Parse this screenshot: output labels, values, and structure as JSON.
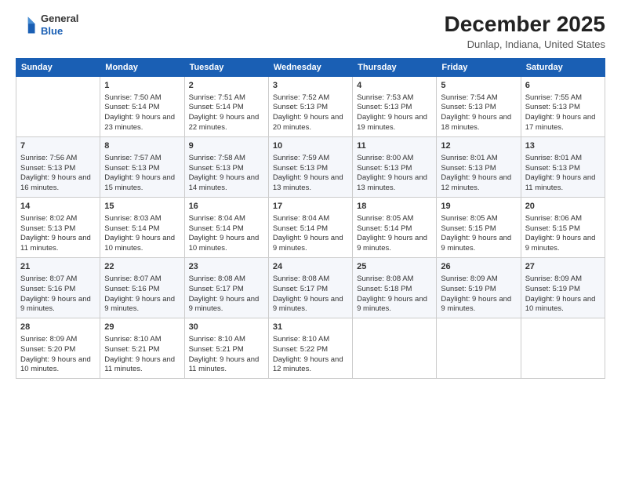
{
  "header": {
    "logo_general": "General",
    "logo_blue": "Blue",
    "title": "December 2025",
    "location": "Dunlap, Indiana, United States"
  },
  "calendar": {
    "days_of_week": [
      "Sunday",
      "Monday",
      "Tuesday",
      "Wednesday",
      "Thursday",
      "Friday",
      "Saturday"
    ],
    "weeks": [
      [
        {
          "day": "",
          "info": ""
        },
        {
          "day": "1",
          "info": "Sunrise: 7:50 AM\nSunset: 5:14 PM\nDaylight: 9 hours and 23 minutes."
        },
        {
          "day": "2",
          "info": "Sunrise: 7:51 AM\nSunset: 5:14 PM\nDaylight: 9 hours and 22 minutes."
        },
        {
          "day": "3",
          "info": "Sunrise: 7:52 AM\nSunset: 5:13 PM\nDaylight: 9 hours and 20 minutes."
        },
        {
          "day": "4",
          "info": "Sunrise: 7:53 AM\nSunset: 5:13 PM\nDaylight: 9 hours and 19 minutes."
        },
        {
          "day": "5",
          "info": "Sunrise: 7:54 AM\nSunset: 5:13 PM\nDaylight: 9 hours and 18 minutes."
        },
        {
          "day": "6",
          "info": "Sunrise: 7:55 AM\nSunset: 5:13 PM\nDaylight: 9 hours and 17 minutes."
        }
      ],
      [
        {
          "day": "7",
          "info": "Sunrise: 7:56 AM\nSunset: 5:13 PM\nDaylight: 9 hours and 16 minutes."
        },
        {
          "day": "8",
          "info": "Sunrise: 7:57 AM\nSunset: 5:13 PM\nDaylight: 9 hours and 15 minutes."
        },
        {
          "day": "9",
          "info": "Sunrise: 7:58 AM\nSunset: 5:13 PM\nDaylight: 9 hours and 14 minutes."
        },
        {
          "day": "10",
          "info": "Sunrise: 7:59 AM\nSunset: 5:13 PM\nDaylight: 9 hours and 13 minutes."
        },
        {
          "day": "11",
          "info": "Sunrise: 8:00 AM\nSunset: 5:13 PM\nDaylight: 9 hours and 13 minutes."
        },
        {
          "day": "12",
          "info": "Sunrise: 8:01 AM\nSunset: 5:13 PM\nDaylight: 9 hours and 12 minutes."
        },
        {
          "day": "13",
          "info": "Sunrise: 8:01 AM\nSunset: 5:13 PM\nDaylight: 9 hours and 11 minutes."
        }
      ],
      [
        {
          "day": "14",
          "info": "Sunrise: 8:02 AM\nSunset: 5:13 PM\nDaylight: 9 hours and 11 minutes."
        },
        {
          "day": "15",
          "info": "Sunrise: 8:03 AM\nSunset: 5:14 PM\nDaylight: 9 hours and 10 minutes."
        },
        {
          "day": "16",
          "info": "Sunrise: 8:04 AM\nSunset: 5:14 PM\nDaylight: 9 hours and 10 minutes."
        },
        {
          "day": "17",
          "info": "Sunrise: 8:04 AM\nSunset: 5:14 PM\nDaylight: 9 hours and 9 minutes."
        },
        {
          "day": "18",
          "info": "Sunrise: 8:05 AM\nSunset: 5:14 PM\nDaylight: 9 hours and 9 minutes."
        },
        {
          "day": "19",
          "info": "Sunrise: 8:05 AM\nSunset: 5:15 PM\nDaylight: 9 hours and 9 minutes."
        },
        {
          "day": "20",
          "info": "Sunrise: 8:06 AM\nSunset: 5:15 PM\nDaylight: 9 hours and 9 minutes."
        }
      ],
      [
        {
          "day": "21",
          "info": "Sunrise: 8:07 AM\nSunset: 5:16 PM\nDaylight: 9 hours and 9 minutes."
        },
        {
          "day": "22",
          "info": "Sunrise: 8:07 AM\nSunset: 5:16 PM\nDaylight: 9 hours and 9 minutes."
        },
        {
          "day": "23",
          "info": "Sunrise: 8:08 AM\nSunset: 5:17 PM\nDaylight: 9 hours and 9 minutes."
        },
        {
          "day": "24",
          "info": "Sunrise: 8:08 AM\nSunset: 5:17 PM\nDaylight: 9 hours and 9 minutes."
        },
        {
          "day": "25",
          "info": "Sunrise: 8:08 AM\nSunset: 5:18 PM\nDaylight: 9 hours and 9 minutes."
        },
        {
          "day": "26",
          "info": "Sunrise: 8:09 AM\nSunset: 5:19 PM\nDaylight: 9 hours and 9 minutes."
        },
        {
          "day": "27",
          "info": "Sunrise: 8:09 AM\nSunset: 5:19 PM\nDaylight: 9 hours and 10 minutes."
        }
      ],
      [
        {
          "day": "28",
          "info": "Sunrise: 8:09 AM\nSunset: 5:20 PM\nDaylight: 9 hours and 10 minutes."
        },
        {
          "day": "29",
          "info": "Sunrise: 8:10 AM\nSunset: 5:21 PM\nDaylight: 9 hours and 11 minutes."
        },
        {
          "day": "30",
          "info": "Sunrise: 8:10 AM\nSunset: 5:21 PM\nDaylight: 9 hours and 11 minutes."
        },
        {
          "day": "31",
          "info": "Sunrise: 8:10 AM\nSunset: 5:22 PM\nDaylight: 9 hours and 12 minutes."
        },
        {
          "day": "",
          "info": ""
        },
        {
          "day": "",
          "info": ""
        },
        {
          "day": "",
          "info": ""
        }
      ]
    ]
  }
}
